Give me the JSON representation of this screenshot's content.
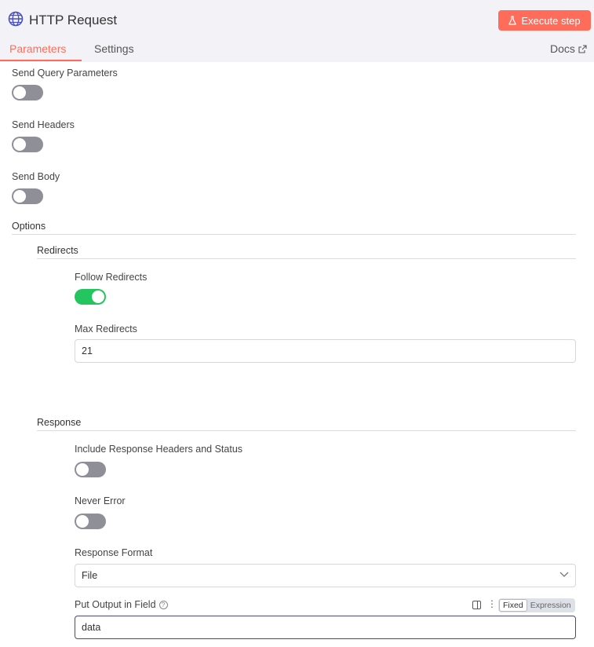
{
  "header": {
    "icon": "globe-icon",
    "title": "HTTP Request",
    "execute_label": "Execute step",
    "execute_color": "#ff6d5a"
  },
  "tabs": [
    {
      "label": "Parameters",
      "active": true
    },
    {
      "label": "Settings",
      "active": false
    }
  ],
  "docs_label": "Docs",
  "params": {
    "send_query": {
      "label": "Send Query Parameters",
      "enabled": false
    },
    "send_headers": {
      "label": "Send Headers",
      "enabled": false
    },
    "send_body": {
      "label": "Send Body",
      "enabled": false
    }
  },
  "options": {
    "title": "Options",
    "redirects": {
      "title": "Redirects",
      "follow": {
        "label": "Follow Redirects",
        "enabled": true
      },
      "max": {
        "label": "Max Redirects",
        "value": "21"
      }
    },
    "response": {
      "title": "Response",
      "include_headers": {
        "label": "Include Response Headers and Status",
        "enabled": false
      },
      "never_error": {
        "label": "Never Error",
        "enabled": false
      },
      "format": {
        "label": "Response Format",
        "value": "File"
      },
      "output_field": {
        "label": "Put Output in Field",
        "value": "data",
        "help": "?",
        "mode_fixed": "Fixed",
        "mode_expression": "Expression"
      }
    }
  },
  "colors": {
    "accent": "#ff6d5a",
    "toggle_on": "#22c55e",
    "toggle_off": "#8f8f98"
  }
}
